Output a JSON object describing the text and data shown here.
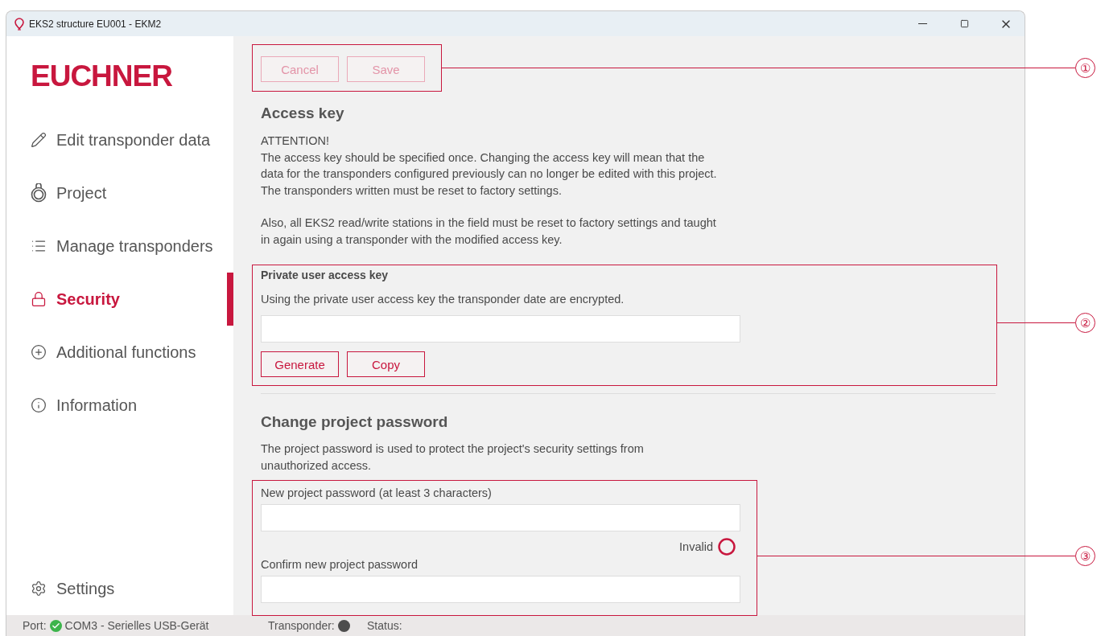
{
  "window": {
    "title": "EKS2 structure EU001 - EKM2"
  },
  "sidebar": {
    "logo": "EUCHNER",
    "items": [
      {
        "label": "Edit transponder data",
        "kind": "pencil",
        "selected": false
      },
      {
        "label": "Project",
        "kind": "tag",
        "selected": false
      },
      {
        "label": "Manage transponders",
        "kind": "list",
        "selected": false
      },
      {
        "label": "Security",
        "kind": "lock",
        "selected": true
      },
      {
        "label": "Additional functions",
        "kind": "plus",
        "selected": false
      },
      {
        "label": "Information",
        "kind": "info",
        "selected": false
      }
    ],
    "settings": {
      "label": "Settings",
      "kind": "gear",
      "selected": false
    }
  },
  "actions": {
    "callout": "①",
    "buttons": [
      {
        "label": "Cancel",
        "disabled": true
      },
      {
        "label": "Save",
        "disabled": true
      }
    ]
  },
  "access_key": {
    "heading": "Access key",
    "paragraphs": [
      "ATTENTION!\nThe access key should be specified once. Changing the access key will mean that the data for the transponders configured previously can no longer be edited with this project. The transponders written must be reset to factory settings.",
      "Also, all EKS2 read/write stations in the field must be reset to factory settings and taught in again using a transponder with the modified access key."
    ]
  },
  "private_key": {
    "callout": "②",
    "title": "Private user access key",
    "text": "Using the private user access key the transponder date are encrypted.",
    "buttons": [
      {
        "label": "Generate",
        "disabled": false
      },
      {
        "label": "Copy",
        "disabled": false
      }
    ]
  },
  "password": {
    "heading": "Change project password",
    "text": "The project password is used to protect the project's security settings from unauthorized access.",
    "callout": "③",
    "new_label": "New project password (at least 3 characters)",
    "validation": {
      "label": "Invalid",
      "valid": false
    },
    "confirm_label": "Confirm new project password"
  },
  "status_bar": {
    "port_label": "Port:",
    "port_connected": true,
    "port": "COM3 - Serielles USB-Gerät",
    "transponder_label": "Transponder:",
    "transponder_present": false,
    "status_label": "Status:"
  }
}
